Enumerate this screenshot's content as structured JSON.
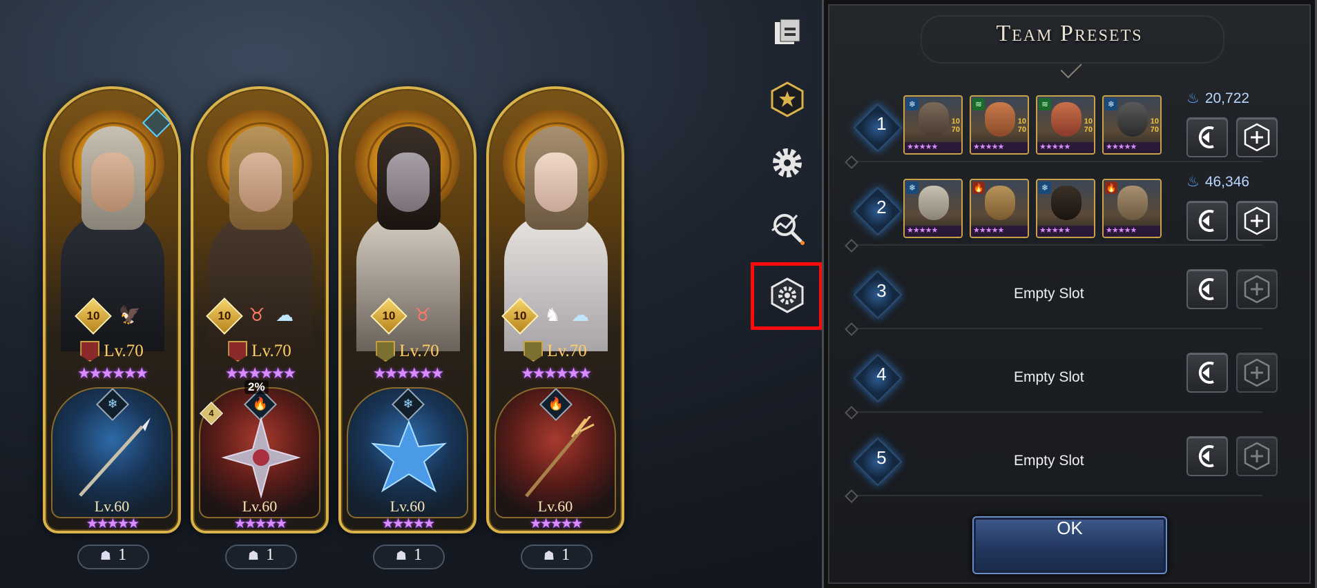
{
  "hero_cards": [
    {
      "badge": "10",
      "level": "Lv.70",
      "stars": "★★★★★★",
      "weapon_level": "Lv.60",
      "weapon_stars": "★★★★★",
      "count": "1",
      "element": "ice",
      "percent": "",
      "side_badge": ""
    },
    {
      "badge": "10",
      "level": "Lv.70",
      "stars": "★★★★★★",
      "weapon_level": "Lv.60",
      "weapon_stars": "★★★★★",
      "count": "1",
      "element": "fire",
      "percent": "2%",
      "side_badge": "4"
    },
    {
      "badge": "10",
      "level": "Lv.70",
      "stars": "★★★★★★",
      "weapon_level": "Lv.60",
      "weapon_stars": "★★★★★",
      "count": "1",
      "element": "ice",
      "percent": "",
      "side_badge": ""
    },
    {
      "badge": "10",
      "level": "Lv.70",
      "stars": "★★★★★★",
      "weapon_level": "Lv.60",
      "weapon_stars": "★★★★★",
      "count": "1",
      "element": "fire",
      "percent": "",
      "side_badge": ""
    }
  ],
  "toolbar": {
    "items": [
      "knight-helmet-icon",
      "star-badge-icon",
      "gear-icon",
      "power-analysis-icon",
      "hex-settings-icon"
    ],
    "highlighted": "hex-settings-icon",
    "highlight_color": "#ff0a0a"
  },
  "panel": {
    "title": "Team Presets",
    "presets": [
      {
        "number": "1",
        "power": "20,722",
        "empty": false
      },
      {
        "number": "2",
        "power": "46,346",
        "empty": false
      },
      {
        "number": "3",
        "label": "Empty Slot",
        "empty": true
      },
      {
        "number": "4",
        "label": "Empty Slot",
        "empty": true
      },
      {
        "number": "5",
        "label": "Empty Slot",
        "empty": true
      }
    ],
    "hero_level_small": [
      "10",
      "70"
    ],
    "ok_label": "OK"
  },
  "colors": {
    "gold": "#d9b24a",
    "level_text": "#ffcf66",
    "star_purple": "#d98cff",
    "ok_blue": "#22365e",
    "power_blue": "#5aa8ff"
  }
}
